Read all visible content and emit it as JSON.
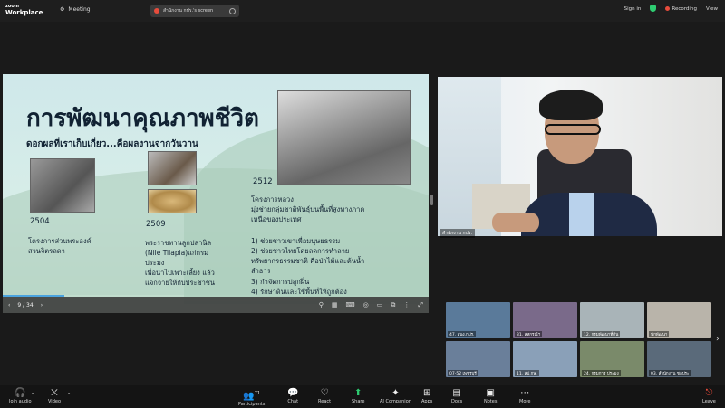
{
  "topbar": {
    "logo_line1": "zoom",
    "logo_line2": "Workplace",
    "meeting_label": "Meeting",
    "tab_title": "สำนักงาน กปร.'s screen",
    "signin": "Sign in",
    "recording": "Recording",
    "view": "View"
  },
  "slide": {
    "title": "การพัฒนาคุณภาพชีวิต",
    "subtitle": "ดอกผลที่เราเก็บเกี่ยว...คือผลงานจากวันวาน",
    "col1": {
      "year": "2504",
      "line1": "โครงการส่วนพระองค์",
      "line2": "สวนจิตรลดา"
    },
    "col2": {
      "year": "2509",
      "line1": "พระราชทานลูกปลานิล",
      "line2": "(Nile Tilapia)แก่กรม",
      "line3": "ประมง",
      "line4": "เพื่อนำไปเพาะเลี้ยง แล้ว",
      "line5": "แจกจ่ายให้กับประชาชน"
    },
    "col3": {
      "year": "2512",
      "line1": "โครงการหลวง",
      "line2": "มุ่งช่วยกลุ่มชาติพันธุ์บนพื้นที่สูงทางภาค",
      "line3": "เหนือของประเทศ",
      "line4": "1) ช่วยชาวเขาเพื่อมนุษยธรรม",
      "line5": "2) ช่วยชาวไทยโดยลดการทำลาย",
      "line6": "ทรัพยากรธรรมชาติ คือป่าไม้และต้นน้ำ",
      "line7": "ลำธาร",
      "line8": "3) กำจัดการปลูกฝิ่น",
      "line9": "4) รักษาดินและใช้พื้นที่ให้ถูกต้อง"
    }
  },
  "slide_toolbar": {
    "prev": "‹",
    "page": "9 / 34",
    "next": "›"
  },
  "speaker": {
    "name": "สำนักงาน กปร."
  },
  "gallery": {
    "tiles": [
      {
        "label": "47. สนง.กปร.",
        "color": "#5a7a9a"
      },
      {
        "label": "31. สหกรณ์ฯ",
        "color": "#7a6a8a"
      },
      {
        "label": "12. กรมพัฒนาที่ดิน",
        "color": "#a9b4b8"
      },
      {
        "label": "นักพัฒนา",
        "color": "#b9b4aa"
      },
      {
        "label": "07-52 เพชรบุรี",
        "color": "#6a7f9a"
      },
      {
        "label": "11. สป.กษ.",
        "color": "#8aa0b8"
      },
      {
        "label": "24. กรมการ ประมง",
        "color": "#7a8a6a"
      },
      {
        "label": "03. สำนักงาน ชลประ",
        "color": "#5a6a7a"
      }
    ]
  },
  "bottombar": {
    "join_audio": "Join audio",
    "video": "Video",
    "participants": "Participants",
    "participants_count": "71",
    "chat": "Chat",
    "react": "React",
    "share": "Share",
    "ai": "AI Companion",
    "apps": "Apps",
    "docs": "Docs",
    "notes": "Notes",
    "more": "More",
    "leave": "Leave"
  }
}
